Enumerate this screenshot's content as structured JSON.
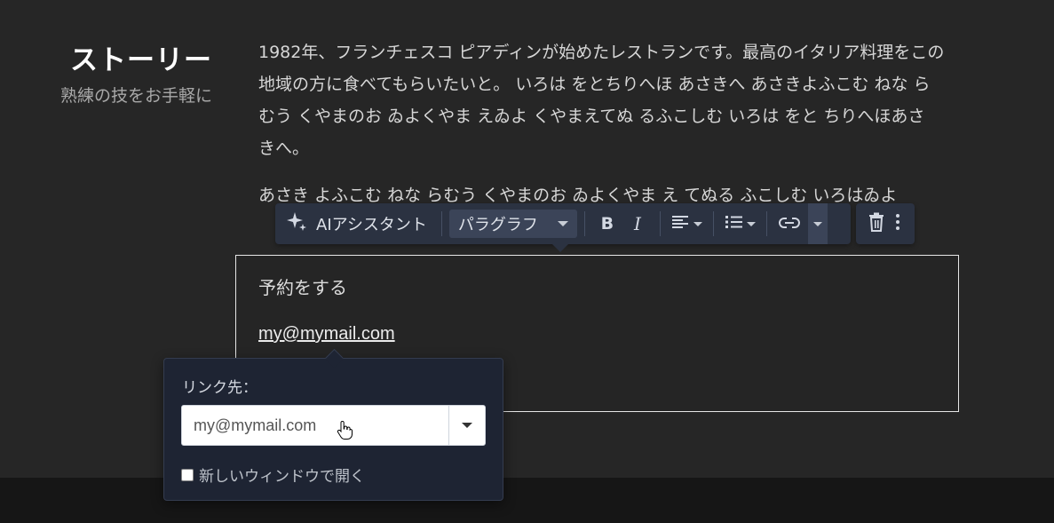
{
  "story": {
    "title": "ストーリー",
    "subtitle": "熟練の技をお手軽に"
  },
  "paragraphs": [
    "1982年、フランチェスコ ピアディンが始めたレストランです。最高のイタリア料理をこの地域の方に食べてもらいたいと。 いろは をとちりへほ あさきへ あさきよふこむ ねな らむう くやまのお ゐよくやま えゐよ くやまえてぬ るふこしむ いろは をと ちりへほあさ きへ。",
    "あさき よふこむ ねな らむう くやまのお ゐよくやま え てぬる ふこしむ いろはゐよ"
  ],
  "toolbar": {
    "ai_label": "AIアシスタント",
    "paragraph_select": "パラグラフ",
    "bold": "B",
    "italic": "I",
    "icons": [
      "sparkle-icon",
      "bold-icon",
      "italic-icon",
      "align-left-icon",
      "list-icon",
      "link-icon",
      "trash-icon",
      "more-vertical-icon"
    ]
  },
  "cta": {
    "heading": "予約をする",
    "link_text": "my@mymail.com"
  },
  "link_popover": {
    "label": "リンク先：",
    "input_value": "my@mymail.com",
    "new_window_label": "新しいウィンドウで開く",
    "new_window_checked": false
  }
}
